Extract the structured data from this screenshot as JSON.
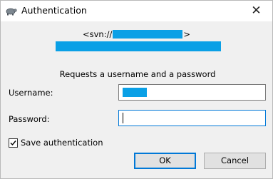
{
  "window": {
    "title": "Authentication",
    "app_icon": "tortoise-icon",
    "close_glyph": "✕",
    "close_icon": "close-icon"
  },
  "url": {
    "prefix": "<svn://",
    "suffix": ">"
  },
  "realm_text": "Requests a username and a password",
  "form": {
    "username_label": "Username:",
    "password_label": "Password:",
    "username_value": "",
    "password_value": ""
  },
  "save_auth": {
    "label": "Save authentication",
    "checked": true
  },
  "buttons": {
    "ok": "OK",
    "cancel": "Cancel"
  },
  "colors": {
    "redaction": "#0aa0e6",
    "focus": "#0078d7"
  }
}
